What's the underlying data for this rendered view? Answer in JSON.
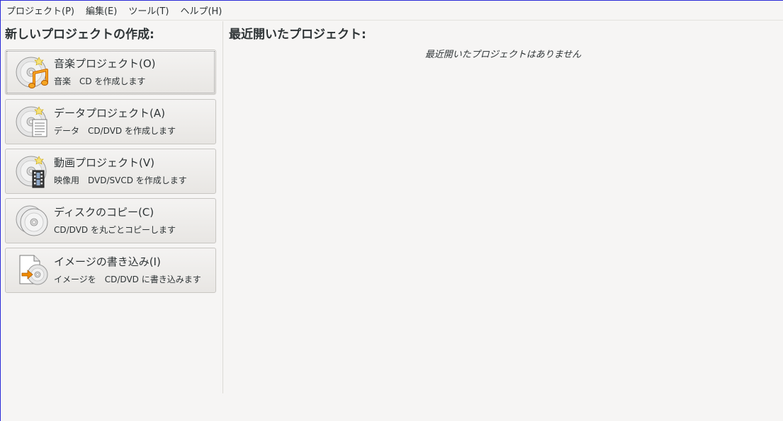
{
  "menu": {
    "items": [
      "プロジェクト(P)",
      "編集(E)",
      "ツール(T)",
      "ヘルプ(H)"
    ]
  },
  "left": {
    "title": "新しいプロジェクトの作成:",
    "buttons": [
      {
        "label": "音楽プロジェクト(O)",
        "desc": "音楽　CD を作成します",
        "icon": "music-cd-icon"
      },
      {
        "label": "データプロジェクト(A)",
        "desc": "データ　CD/DVD を作成します",
        "icon": "data-disc-icon"
      },
      {
        "label": "動画プロジェクト(V)",
        "desc": "映像用　DVD/SVCD を作成します",
        "icon": "video-disc-icon"
      },
      {
        "label": "ディスクのコピー(C)",
        "desc": "CD/DVD を丸ごとコピーします",
        "icon": "copy-disc-icon"
      },
      {
        "label": "イメージの書き込み(I)",
        "desc": "イメージを　CD/DVD に書き込みます",
        "icon": "burn-image-icon"
      }
    ]
  },
  "right": {
    "title": "最近開いたプロジェクト:",
    "empty_message": "最近開いたプロジェクトはありません"
  }
}
